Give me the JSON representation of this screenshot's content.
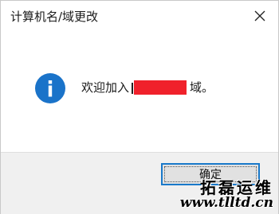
{
  "window": {
    "title": "计算机名/域更改",
    "close_icon": "close-icon"
  },
  "message": {
    "icon": "info-icon",
    "prefix": "欢迎加入",
    "suffix": "域。",
    "redaction_color": "#f0212b"
  },
  "buttons": {
    "ok_label": "确定"
  },
  "watermark": {
    "brand": "拓磊运维",
    "url": "www.tlltd.cn"
  },
  "colors": {
    "info_blue": "#1a73c9",
    "button_border": "#1979ca",
    "footer_bg": "#f0f0f0"
  }
}
